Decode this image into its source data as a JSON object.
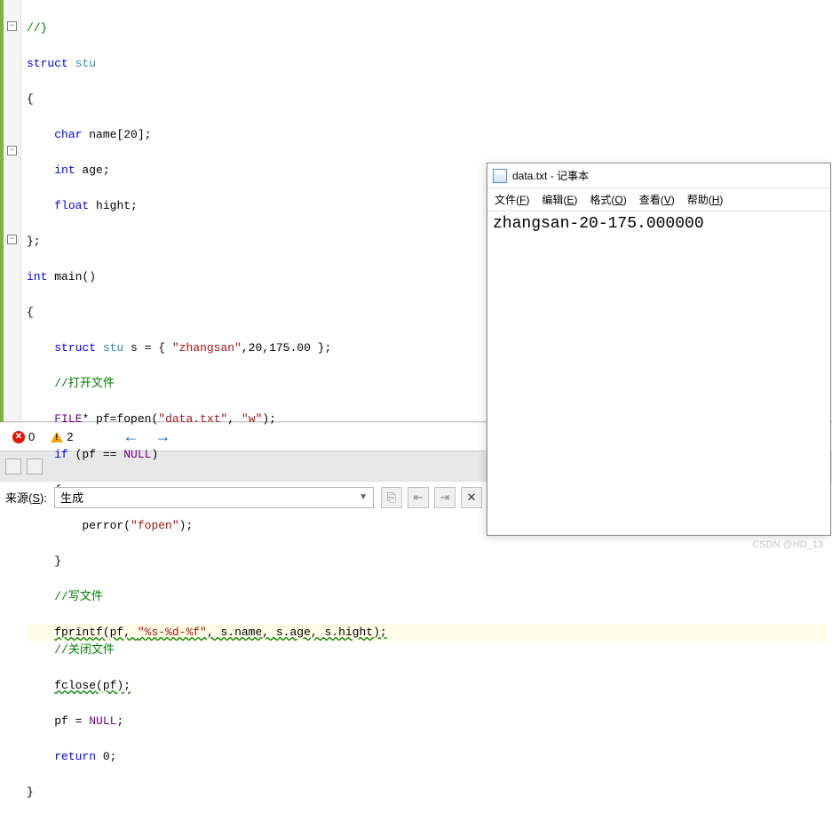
{
  "code": {
    "line1": "//}",
    "struct_kw": "struct",
    "struct_name": "stu",
    "brace_open": "{",
    "char_kw": "char",
    "name_decl": " name[20];",
    "int_kw": "int",
    "age_decl": " age;",
    "float_kw": "float",
    "hight_decl": " hight;",
    "brace_close_semi": "};",
    "main_sig_int": "int",
    "main_sig_rest": " main()",
    "decl_struct": "struct",
    "decl_stu": " stu",
    "decl_rest": " s = { ",
    "decl_str": "\"zhangsan\"",
    "decl_nums": ",20,175.00 };",
    "comment_open": "//打开文件",
    "file_macro": "FILE",
    "file_rest": "* pf=",
    "fopen": "fopen",
    "fopen_args_open": "(",
    "fopen_str1": "\"data.txt\"",
    "fopen_comma": ", ",
    "fopen_str2": "\"w\"",
    "fopen_close": ");",
    "if_kw": "if",
    "if_cond": " (pf == ",
    "null_kw": "NULL",
    "if_close": ")",
    "perror": "perror",
    "perror_open": "(",
    "perror_str": "\"fopen\"",
    "perror_close": ");",
    "comment_write": "//写文件",
    "fprintf": "fprintf",
    "fprintf_open": "(pf, ",
    "fprintf_str": "\"%s-%d-%f\"",
    "fprintf_args": ", s.name, s.age, s.hight);",
    "comment_close": "//关闭文件",
    "fclose": "fclose",
    "fclose_args": "(pf);",
    "pf_null": "pf = ",
    "pf_null2": "NULL",
    "pf_semi": ";",
    "return_kw": "return",
    "return_val": " 0;"
  },
  "status": {
    "errors": "0",
    "warnings": "2"
  },
  "sourceRow": {
    "label_prefix": "来源(",
    "label_key": "S",
    "label_suffix": "):",
    "combo_value": "生成"
  },
  "notepad": {
    "title": "data.txt - 记事本",
    "menu_file": "文件(F)",
    "menu_edit": "编辑(E)",
    "menu_format": "格式(O)",
    "menu_view": "查看(V)",
    "menu_help": "帮助(H)",
    "body": "zhangsan-20-175.000000"
  },
  "watermark": "CSDN @HD_13"
}
